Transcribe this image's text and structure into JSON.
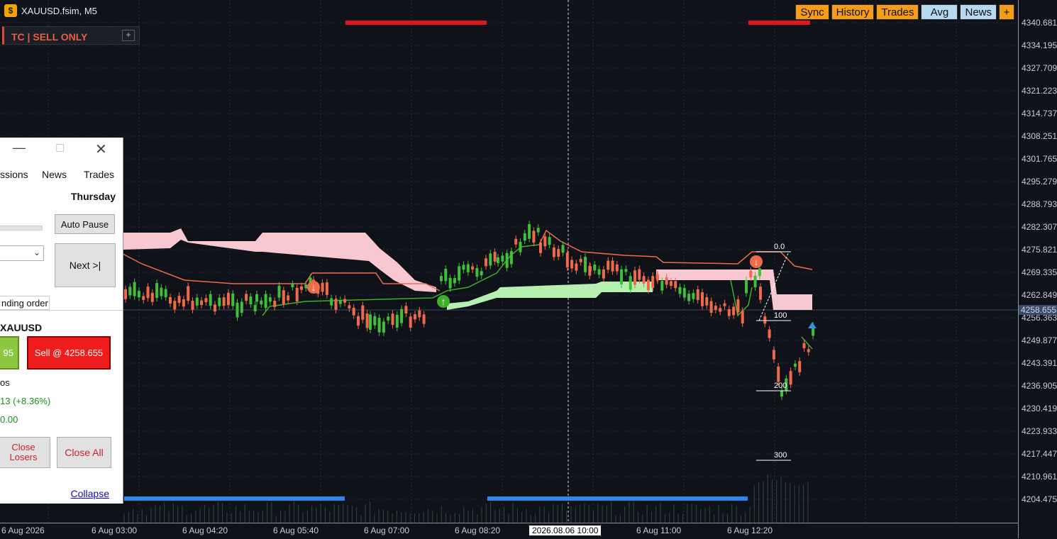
{
  "window": {
    "title": "XAUUSD.fsim, M5",
    "icon": "dollar-chart-icon"
  },
  "tc_panel": {
    "text": "TC  |  SELL ONLY",
    "plus": "+"
  },
  "toolbar": {
    "sync": "Sync",
    "history": "History",
    "trades": "Trades",
    "avg": "Avg",
    "news": "News",
    "plus": "+"
  },
  "price_axis": {
    "labels": [
      "4340.681",
      "4334.195",
      "4327.709",
      "4321.223",
      "4314.737",
      "4308.251",
      "4301.765",
      "4295.279",
      "4288.793",
      "4282.307",
      "4275.821",
      "4269.335",
      "4262.849",
      "4256.363",
      "4249.877",
      "4243.391",
      "4236.905",
      "4230.419",
      "4223.933",
      "4217.447",
      "4210.961",
      "4204.475"
    ],
    "current": "4258.655"
  },
  "time_axis": {
    "labels": [
      "6 Aug 2026",
      "6 Aug 03:00",
      "6 Aug 04:20",
      "6 Aug 05:40",
      "6 Aug 07:00",
      "6 Aug 08:20",
      "6 Aug 11:00",
      "6 Aug 12:20"
    ],
    "cursor": "2026.08.06 10:00"
  },
  "fib": {
    "l0": "0.0",
    "l100": "100",
    "l200": "200",
    "l300": "300"
  },
  "panel": {
    "menu": {
      "sessions": "ssions",
      "news": "News",
      "trades": "Trades"
    },
    "day": "Thursday",
    "auto_pause": "Auto Pause",
    "next": "Next >|",
    "pending_tab": "nding order",
    "symbol": "XAUUSD",
    "buy_label": "95",
    "sell_label": "Sell @ 4258.655",
    "positions_label": "os",
    "profit": "13  (+8.36%)",
    "profit_color": "#1a8f1a",
    "balance": "0.00",
    "close_losers": "Close Losers",
    "close_all": "Close All",
    "collapse": "Collapse"
  }
}
